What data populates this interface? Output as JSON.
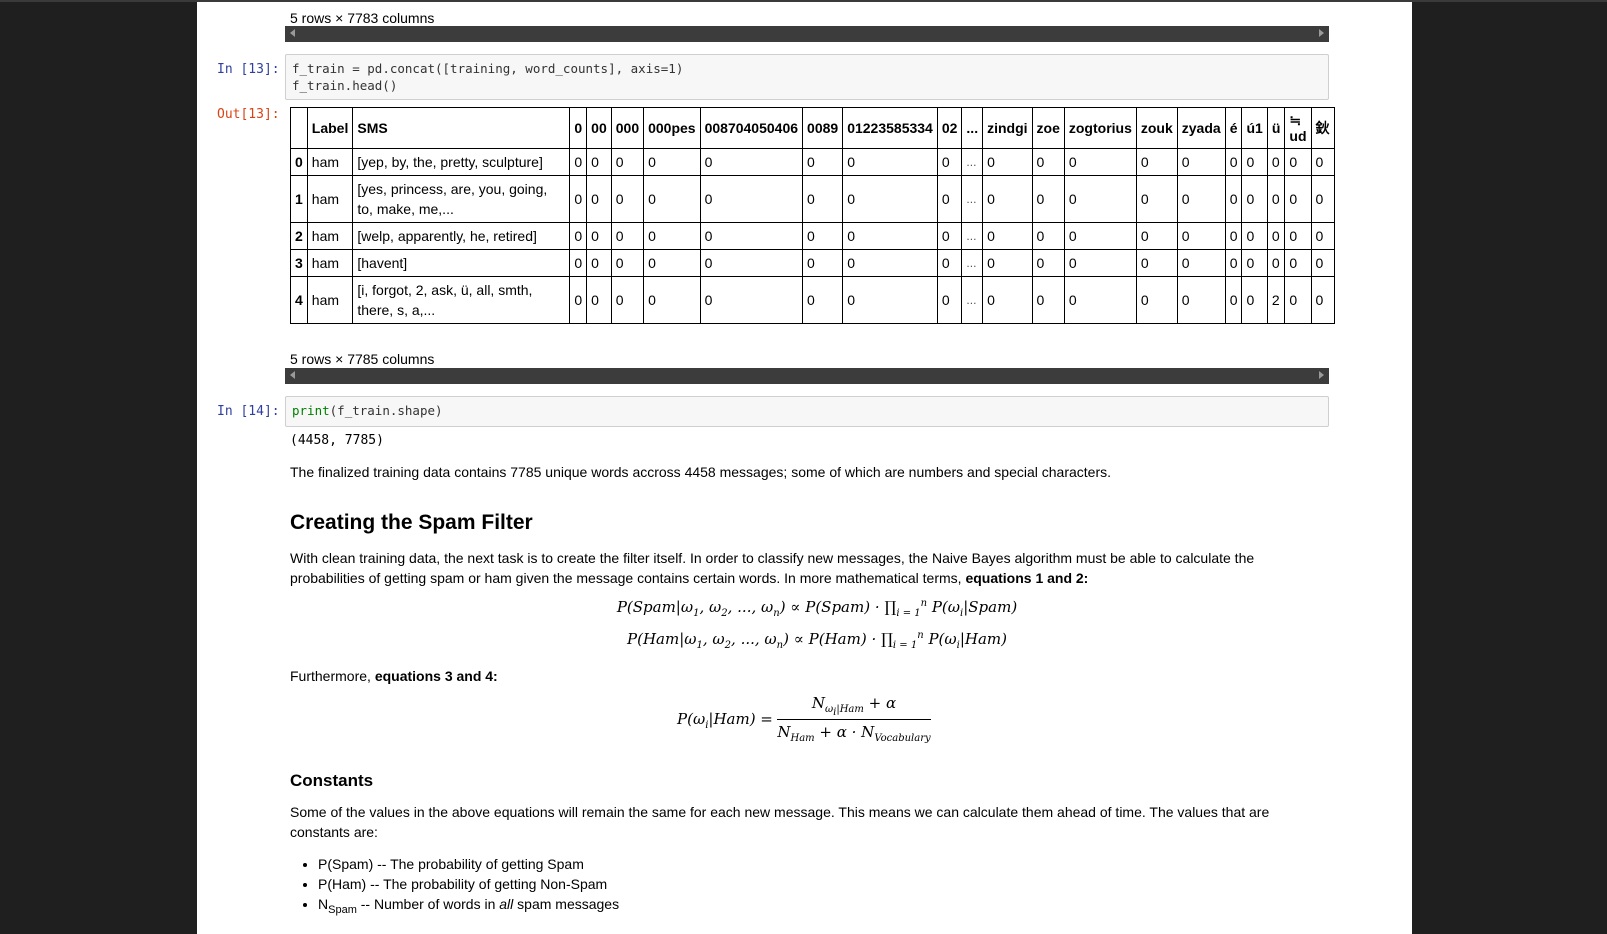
{
  "cells": {
    "prev_output_note": "5 rows × 7783 columns",
    "cell13": {
      "prompt_in": "In [13]:",
      "code_line1_var": "f_train",
      "code_line1_rest": " = pd.concat([training, word_counts], axis=1)",
      "code_line2": "f_train.head()",
      "prompt_out": "Out[13]:",
      "table": {
        "columns": [
          "",
          "Label",
          "SMS",
          "0",
          "00",
          "000",
          "000pes",
          "008704050406",
          "0089",
          "01223585334",
          "02",
          "...",
          "zindgi",
          "zoe",
          "zogtorius",
          "zouk",
          "zyada",
          "é",
          "ú1",
          "ü",
          "≒\nud",
          "鈥"
        ],
        "rows": [
          {
            "index": "0",
            "label": "ham",
            "sms": "[yep, by, the, pretty, sculpture]",
            "values": [
              "0",
              "0",
              "0",
              "0",
              "0",
              "0",
              "0",
              "0",
              "...",
              "0",
              "0",
              "0",
              "0",
              "0",
              "0",
              "0",
              "0",
              "0",
              "0"
            ]
          },
          {
            "index": "1",
            "label": "ham",
            "sms": "[yes, princess, are, you, going, to, make, me,...",
            "values": [
              "0",
              "0",
              "0",
              "0",
              "0",
              "0",
              "0",
              "0",
              "...",
              "0",
              "0",
              "0",
              "0",
              "0",
              "0",
              "0",
              "0",
              "0",
              "0"
            ]
          },
          {
            "index": "2",
            "label": "ham",
            "sms": "[welp, apparently, he, retired]",
            "values": [
              "0",
              "0",
              "0",
              "0",
              "0",
              "0",
              "0",
              "0",
              "...",
              "0",
              "0",
              "0",
              "0",
              "0",
              "0",
              "0",
              "0",
              "0",
              "0"
            ]
          },
          {
            "index": "3",
            "label": "ham",
            "sms": "[havent]",
            "values": [
              "0",
              "0",
              "0",
              "0",
              "0",
              "0",
              "0",
              "0",
              "...",
              "0",
              "0",
              "0",
              "0",
              "0",
              "0",
              "0",
              "0",
              "0",
              "0"
            ]
          },
          {
            "index": "4",
            "label": "ham",
            "sms": "[i, forgot, 2, ask, ü, all, smth, there, s, a,...",
            "values": [
              "0",
              "0",
              "0",
              "0",
              "0",
              "0",
              "0",
              "0",
              "...",
              "0",
              "0",
              "0",
              "0",
              "0",
              "0",
              "0",
              "2",
              "0",
              "0"
            ]
          }
        ]
      },
      "output_note": "5 rows × 7785 columns"
    },
    "cell14": {
      "prompt_in": "In [14]:",
      "code_fn": "print",
      "code_rest": "(f_train.shape)",
      "output": "(4458, 7785)"
    },
    "markdown": {
      "para1": "The finalized training data contains 7785 unique words accross 4458 messages; some of which are numbers and special characters.",
      "heading": "Creating the Spam Filter",
      "para2_text": "With clean training data, the next task is to create the filter itself. In order to classify new messages, the Naive Bayes algorithm must be able to calculate the probabilities of getting spam or ham given the message contains certain words. In more mathematical terms, ",
      "para2_bold": "equations 1 and 2:",
      "para3_text": "Furthermore, ",
      "para3_bold": "equations 3 and 4:",
      "subheading": "Constants",
      "para4": "Some of the values in the above equations will remain the same for each new message. This means we can calculate them ahead of time. The values that are constants are:",
      "list": [
        "P(Spam) -- The probability of getting Spam",
        "P(Ham) -- The probability of getting Non-Spam"
      ],
      "list3_main": "N",
      "list3_sub": "Spam",
      "list3_text": " -- Number of words in ",
      "list3_em": "all",
      "list3_end": " spam messages"
    }
  },
  "colors": {
    "background": "#1f1f1f",
    "page": "#ffffff",
    "prompt_in": "#303f9f",
    "prompt_out": "#d84315",
    "scrollbar": "#3c3c3c"
  }
}
